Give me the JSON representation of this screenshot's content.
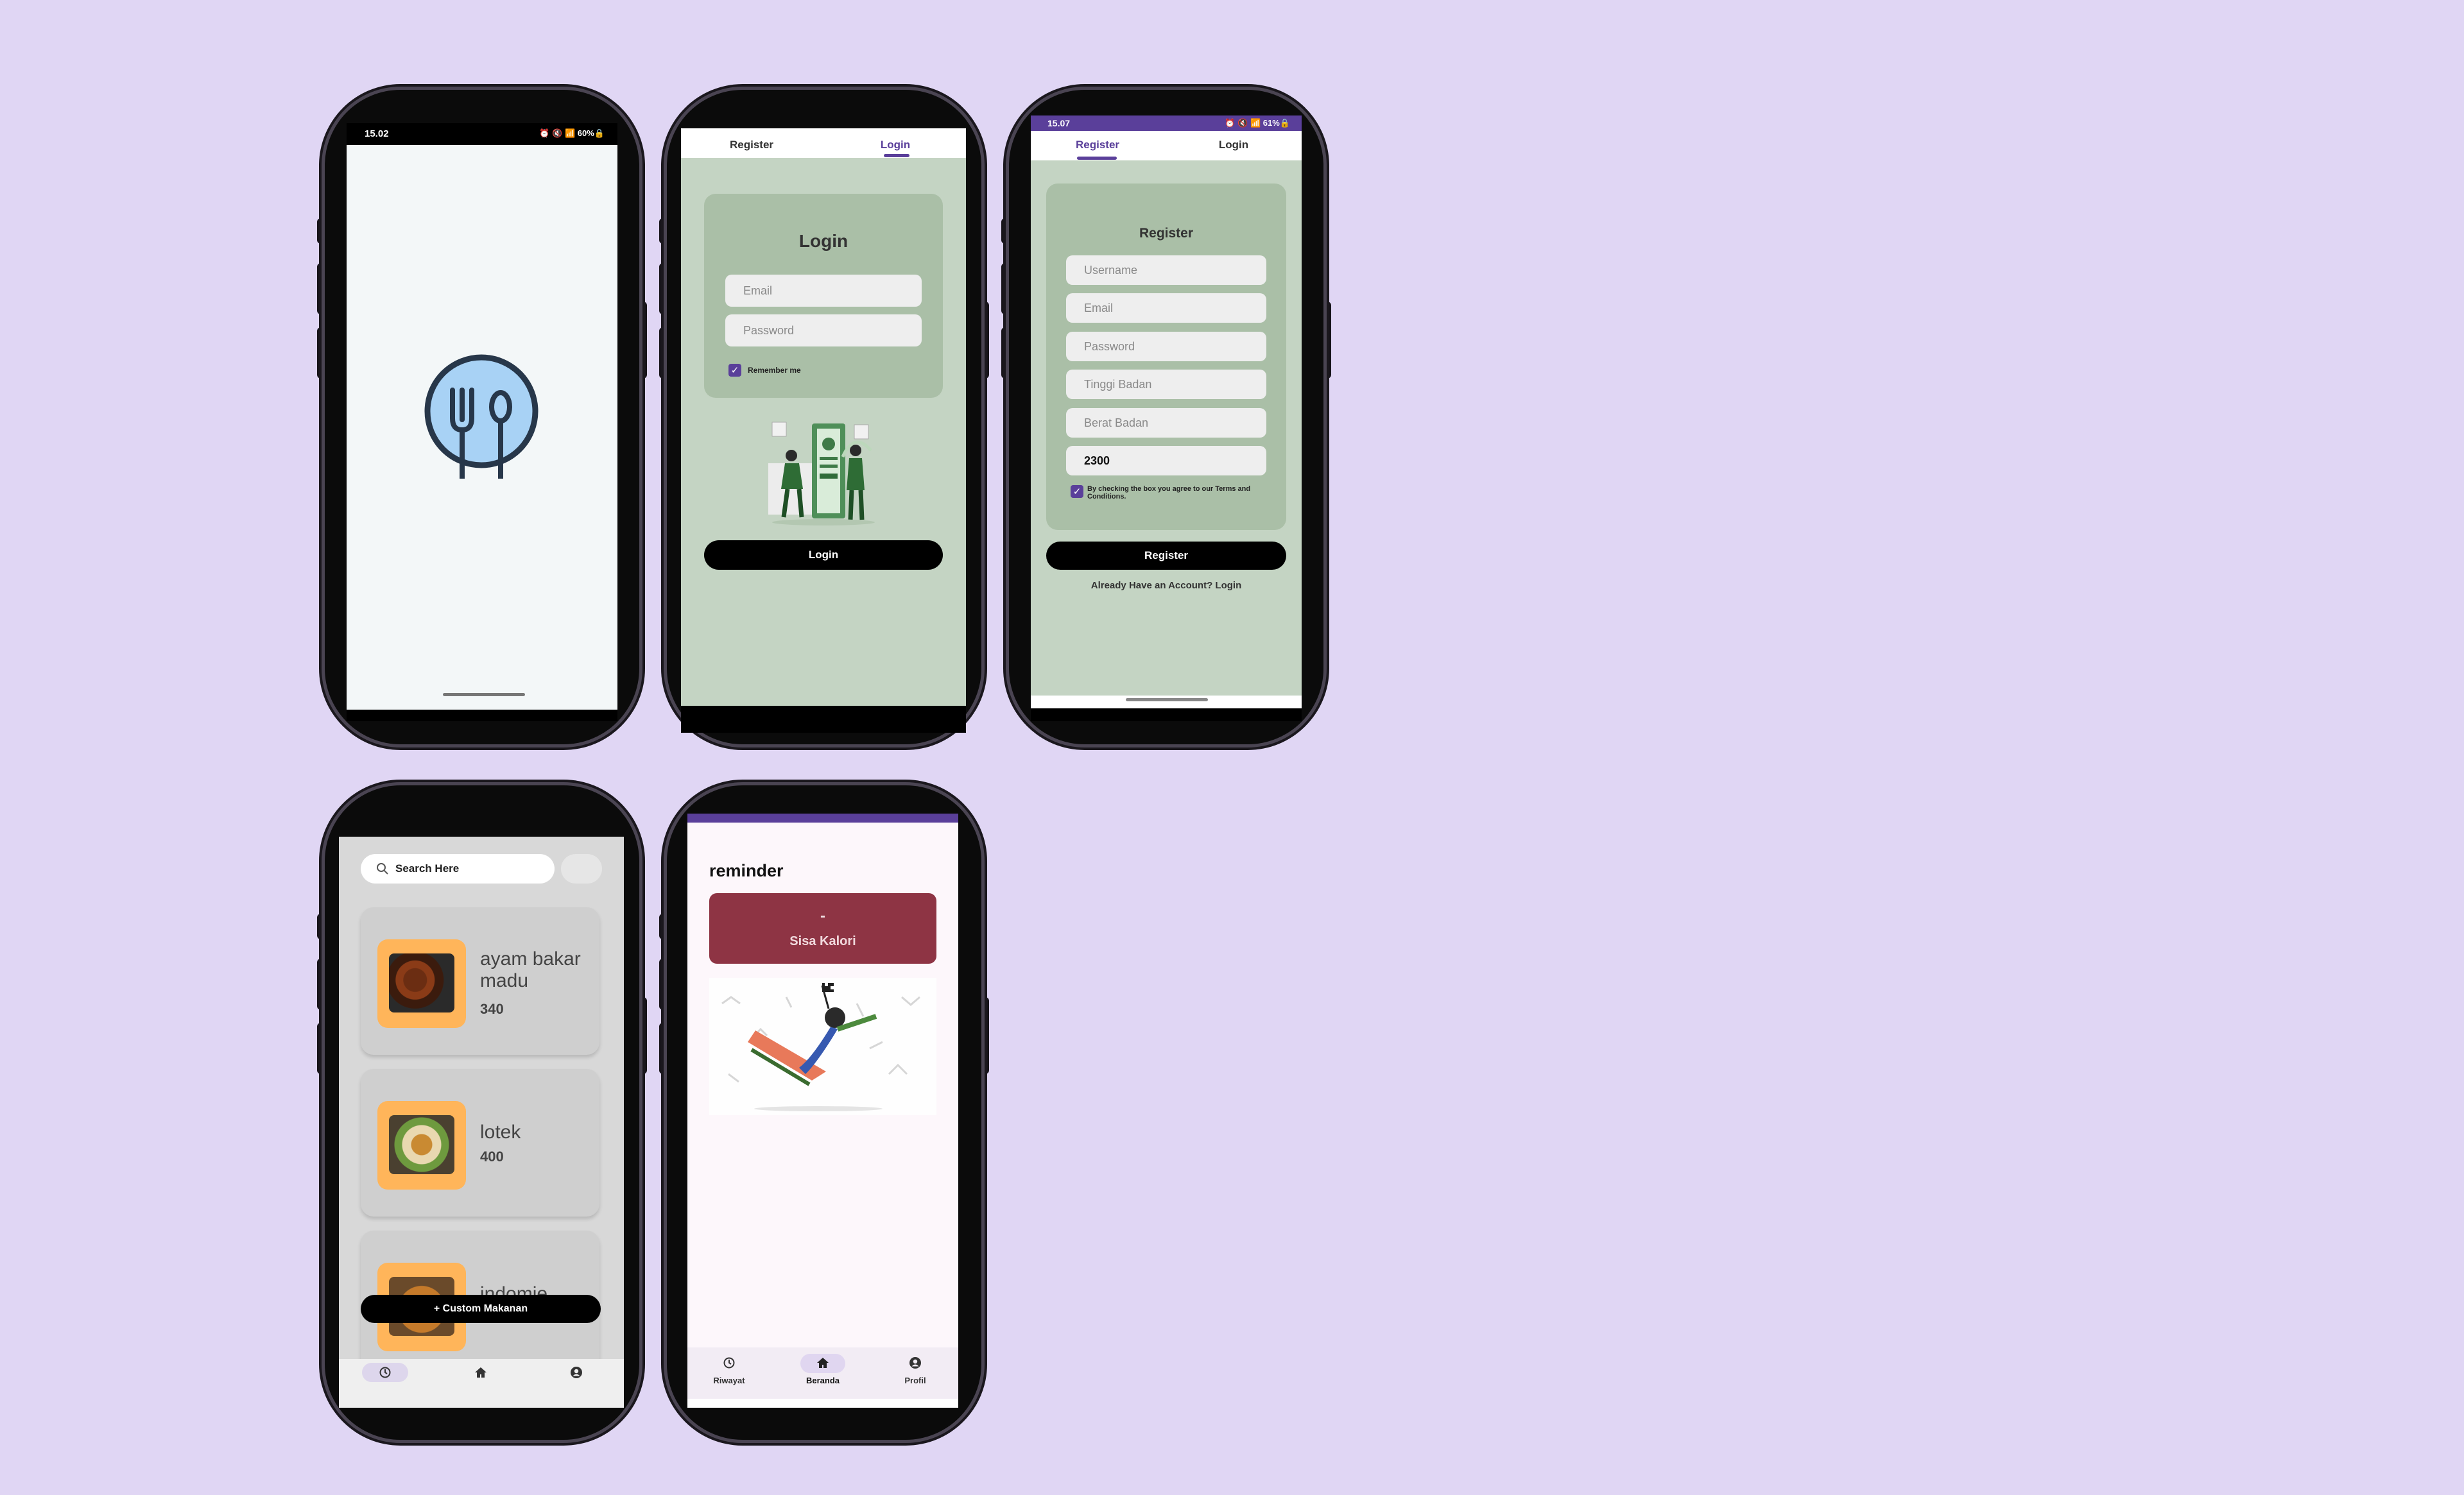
{
  "colors": {
    "background": "#e0d6f4",
    "accent": "#5a3f9a",
    "card_green": "#aabfa7",
    "screen_green": "#c4d4c3",
    "calorie_red": "#8e3444",
    "thumb_orange": "#ffb55a"
  },
  "splash": {
    "time": "15.02",
    "status_icons": "⏰ 🔇 📶 60%🔒",
    "logo_icon": "fork-spoon-plate-icon"
  },
  "login": {
    "tabs": [
      "Register",
      "Login"
    ],
    "active_tab": "Login",
    "title": "Login",
    "email_placeholder": "Email",
    "password_placeholder": "Password",
    "remember_label": "Remember me",
    "remember_checked": true,
    "submit_label": "Login"
  },
  "register": {
    "time": "15.07",
    "status_icons": "⏰ 🔇 📶 61%🔒",
    "tabs": [
      "Register",
      "Login"
    ],
    "active_tab": "Register",
    "title": "Register",
    "username_placeholder": "Username",
    "email_placeholder": "Email",
    "password_placeholder": "Password",
    "height_placeholder": "Tinggi Badan",
    "weight_placeholder": "Berat Badan",
    "calorie_value": "2300",
    "terms_text": "By checking the box you agree to our Terms and Conditions.",
    "terms_checked": true,
    "submit_label": "Register",
    "footer_link": "Already Have an Account? Login"
  },
  "food_list": {
    "search_placeholder": "Search Here",
    "items": [
      {
        "name": "ayam bakar madu",
        "calories": "340"
      },
      {
        "name": "lotek",
        "calories": "400"
      },
      {
        "name": "indomie",
        "calories": ""
      }
    ],
    "custom_button": "+ Custom Makanan",
    "nav": [
      "history-icon",
      "home-icon",
      "profile-icon"
    ]
  },
  "reminder": {
    "title": "reminder",
    "calorie_value": "-",
    "calorie_label": "Sisa Kalori",
    "nav": [
      {
        "label": "Riwayat",
        "icon": "history-icon"
      },
      {
        "label": "Beranda",
        "icon": "home-icon",
        "active": true
      },
      {
        "label": "Profil",
        "icon": "profile-icon"
      }
    ]
  }
}
